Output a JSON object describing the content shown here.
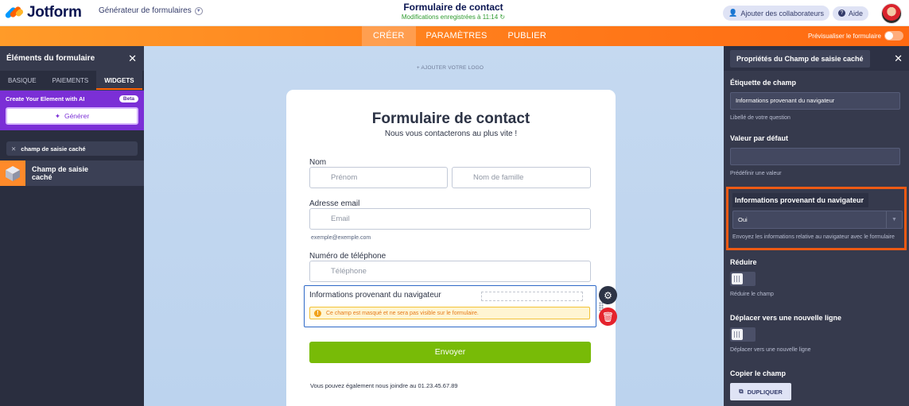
{
  "header": {
    "brand": "Jotform",
    "builder_label": "Générateur de formulaires",
    "form_title": "Formulaire de contact",
    "save_status": "Modifications enregistrées à 11:14",
    "add_collaborators": "Ajouter des collaborateurs",
    "help": "Aide"
  },
  "nav": {
    "tabs": [
      "CRÉER",
      "PARAMÈTRES",
      "PUBLIER"
    ],
    "active_tab": "CRÉER",
    "preview_label": "Prévisualiser le formulaire"
  },
  "left_panel": {
    "title": "Éléments du formulaire",
    "tabs": [
      "BASIQUE",
      "PAIEMENTS",
      "WIDGETS"
    ],
    "active_tab": "WIDGETS",
    "ai_title": "Create Your Element with AI",
    "ai_badge": "Beta",
    "generate_label": "Générer",
    "search_tag": "champ de saisie caché",
    "element_label": "Champ de saisie caché"
  },
  "canvas": {
    "add_logo": "+ AJOUTER VOTRE LOGO",
    "form": {
      "title": "Formulaire de contact",
      "subtitle": "Nous vous contacterons au plus vite !",
      "name_label": "Nom",
      "first_name_placeholder": "Prénom",
      "last_name_placeholder": "Nom de famille",
      "email_label": "Adresse email",
      "email_placeholder": "Email",
      "email_hint": "exemple@exemple.com",
      "phone_label": "Numéro de téléphone",
      "phone_placeholder": "Téléphone",
      "hidden_label": "Informations provenant du navigateur",
      "hidden_warning": "Ce champ est masqué et ne sera pas visible sur le formulaire.",
      "submit_label": "Envoyer",
      "footer_text": "Vous pouvez également nous joindre au 01.23.45.67.89"
    }
  },
  "right_panel": {
    "title": "Propriétés du Champ de saisie caché",
    "field_label_title": "Étiquette de champ",
    "field_label_value": "Informations provenant du navigateur",
    "field_label_desc": "Libellé de votre question",
    "default_value_title": "Valeur par défaut",
    "default_value_value": "",
    "default_value_desc": "Prédéfinir une valeur",
    "browser_info_title": "Informations provenant du navigateur",
    "browser_info_value": "Oui",
    "browser_info_desc": "Envoyez les informations relative au navigateur avec le formulaire",
    "shrink_title": "Réduire",
    "shrink_desc": "Réduire le champ",
    "move_title": "Déplacer vers une nouvelle ligne",
    "move_desc": "Déplacer vers une nouvelle ligne",
    "copy_title": "Copier le champ",
    "duplicate_label": "DUPLIQUER"
  },
  "colors": {
    "orange": "#ff7a1a",
    "brand_navy": "#0a1551",
    "purple": "#7b2fd6",
    "submit_green": "#78bb07",
    "highlight_red": "#ee5a14"
  }
}
